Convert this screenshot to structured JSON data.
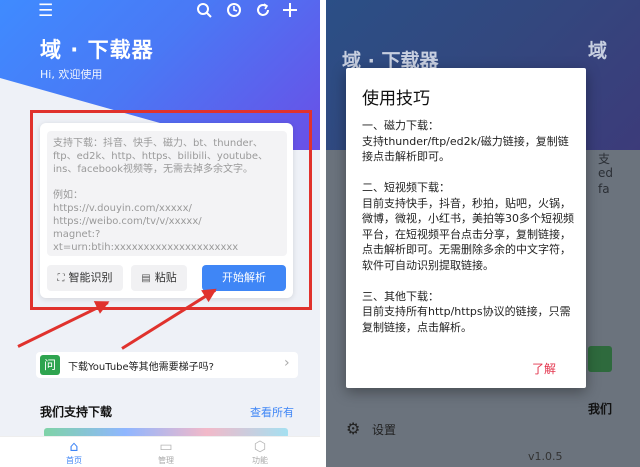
{
  "left": {
    "app_title": "域 · 下载器",
    "subtitle": "Hi, 欢迎使用",
    "input_placeholder": "支持下载：抖音、快手、磁力、bt、thunder、ftp、ed2k、http、https、bilibili、youtube、ins、facebook视频等，无需去掉多余文字。\n\n例如：\nhttps://v.douyin.com/xxxxx/\nhttps://weibo.com/tv/v/xxxxx/\nmagnet:?xt=urn:btih:xxxxxxxxxxxxxxxxxxxxx",
    "smart_recognize": "智能识别",
    "paste": "粘贴",
    "start_parse": "开始解析",
    "tip_badge": "问",
    "tip_text": "下载YouTube等其他需要梯子吗?",
    "section_title": "我们支持下载",
    "section_more": "查看所有",
    "nav": {
      "home": "首页",
      "manage": "管理",
      "features": "功能"
    }
  },
  "right": {
    "bg_title": "域 · 下载器",
    "bg_title_partial": "域",
    "bg_zh_partial": "我们",
    "bg_settings": "设置",
    "bg_version": "v1.0.5",
    "bg_snippets": [
      "支",
      "ed",
      "fa"
    ],
    "dialog": {
      "title": "使用技巧",
      "body": "一、磁力下载：\n支持thunder/ftp/ed2k/磁力链接，复制链接点击解析即可。\n\n二、短视频下载：\n目前支持快手，抖音，秒拍，贴吧，火锅，微博，微视，小红书，美拍等30多个短视频平台，在短视频平台点击分享，复制链接，点击解析即可。无需删除多余的中文字符，软件可自动识别提取链接。\n\n三、其他下载：\n目前支持所有http/https协议的链接，只需复制链接，点击解析。",
      "ok": "了解"
    }
  },
  "colors": {
    "accent": "#3f86f6",
    "annotation_red": "#e0322d",
    "dialog_ok": "#e3344c"
  }
}
